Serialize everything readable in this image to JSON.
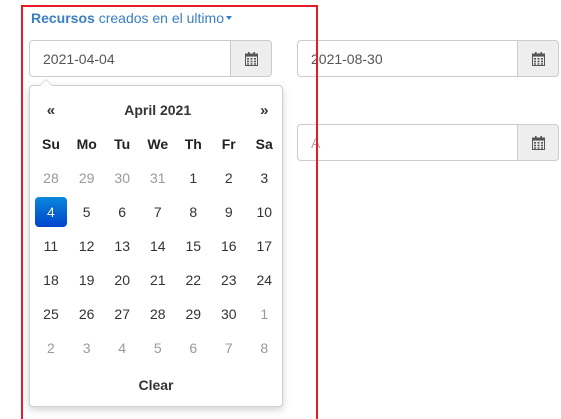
{
  "header": {
    "bold_text": "Recursos",
    "rest_text": "creados en el ultimo"
  },
  "filters": {
    "date_from": "2021-04-04",
    "date_to": "2021-08-30",
    "third_placeholder": "A"
  },
  "datepicker": {
    "prev": "«",
    "title": "April 2021",
    "next": "»",
    "weekdays": [
      "Su",
      "Mo",
      "Tu",
      "We",
      "Th",
      "Fr",
      "Sa"
    ],
    "weeks": [
      [
        "28",
        "29",
        "30",
        "31",
        "1",
        "2",
        "3"
      ],
      [
        "4",
        "5",
        "6",
        "7",
        "8",
        "9",
        "10"
      ],
      [
        "11",
        "12",
        "13",
        "14",
        "15",
        "16",
        "17"
      ],
      [
        "18",
        "19",
        "20",
        "21",
        "22",
        "23",
        "24"
      ],
      [
        "25",
        "26",
        "27",
        "28",
        "29",
        "30",
        "1"
      ],
      [
        "2",
        "3",
        "4",
        "5",
        "6",
        "7",
        "8"
      ]
    ],
    "selected_day": "4",
    "clear_label": "Clear"
  },
  "colors": {
    "link": "#3a7fc1",
    "selected": "#0066cc",
    "highlight_border": "#e81c25",
    "muted_day": "#999999"
  },
  "icons": {
    "addon": "calendar-icon"
  }
}
